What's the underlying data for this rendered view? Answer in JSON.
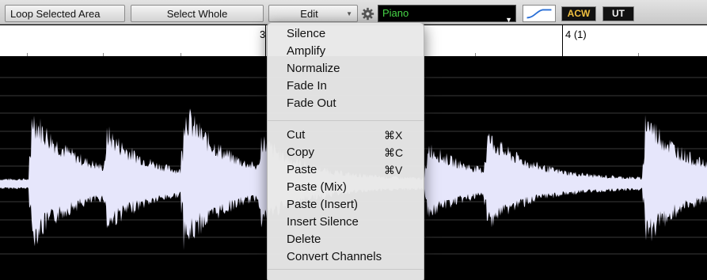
{
  "toolbar": {
    "loop_label": "Loop Selected Area",
    "select_whole_label": "Select Whole",
    "edit_label": "Edit",
    "edit_arrow": "▼",
    "instrument": "Piano",
    "instrument_arrow": "▼",
    "acw_label": "ACW",
    "ut_label": "UT"
  },
  "ruler": {
    "bar3": "3",
    "bar4": "4 (1)"
  },
  "menu": {
    "group1": [
      "Silence",
      "Amplify",
      "Normalize",
      "Fade In",
      "Fade Out"
    ],
    "group2": [
      {
        "label": "Cut",
        "shortcut": "⌘X"
      },
      {
        "label": "Copy",
        "shortcut": "⌘C"
      },
      {
        "label": "Paste",
        "shortcut": "⌘V"
      },
      {
        "label": "Paste (Mix)",
        "shortcut": ""
      },
      {
        "label": "Paste (Insert)",
        "shortcut": ""
      },
      {
        "label": "Insert Silence",
        "shortcut": ""
      },
      {
        "label": "Delete",
        "shortcut": ""
      },
      {
        "label": "Convert Channels",
        "shortcut": ""
      }
    ]
  },
  "colors": {
    "waveform": "#e6e6fb",
    "instrument_text": "#48d848",
    "acw_text": "#f0c040"
  }
}
